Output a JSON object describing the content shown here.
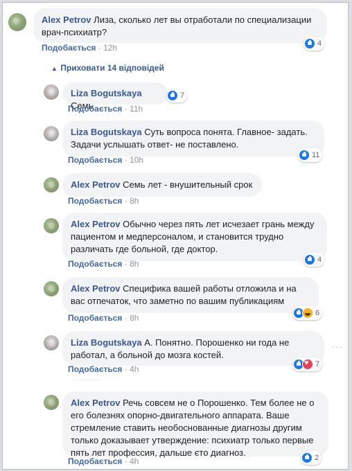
{
  "top_comment": {
    "author": "Alex Petrov",
    "text": "Лиза, сколько лет вы отработали по специализации врач-психиатр?",
    "like_label": "Подобається",
    "time": "12h",
    "reaction_count": "4"
  },
  "hide_replies_label": "Приховати 14 відповідей",
  "replies": [
    {
      "author": "Liza Bogutskaya",
      "text": "Семь",
      "like_label": "Подобається",
      "time": "11h",
      "reaction_count": "7"
    },
    {
      "author": "Liza Bogutskaya",
      "text": "Суть вопроса понята. Главное- задать. Задачи услышать ответ- не поставлено.",
      "like_label": "Подобається",
      "time": "10h",
      "reaction_count": "11"
    },
    {
      "author": "Alex Petrov",
      "text": "Семь лет - внушительный срок",
      "like_label": "Подобається",
      "time": "8h"
    },
    {
      "author": "Alex Petrov",
      "text": "Обычно через пять лет исчезает грань между пациентом и медперсоналом, и становится трудно различать где больной, где доктор.",
      "like_label": "Подобається",
      "time": "8h",
      "reaction_count": "4"
    },
    {
      "author": "Alex Petrov",
      "text": "Специфика вашей работы отложила и на вас отпечаток, что заметно по вашим публикациям",
      "like_label": "Подобається",
      "time": "8h",
      "reaction_count": "6"
    },
    {
      "author": "Liza Bogutskaya",
      "text": "А. Понятно. Порошенко ни года не работал, а больной до мозга костей.",
      "like_label": "Подобається",
      "time": "4h",
      "reaction_count": "7"
    },
    {
      "author": "Alex Petrov",
      "text": "Речь совсем не о Порошенко. Тем более не о его болезнях опорно-двигательного аппарата. Ваше стремление ставить необоснованные диагнозы другим только доказывает утверждение: психиатр только первые пять лет профессия, дальше єто диагноз.",
      "like_label": "Подобається",
      "time": "4h",
      "reaction_count": "2"
    }
  ],
  "separator": "·",
  "colors": {
    "link": "#4267b2",
    "author": "#385898",
    "bubble": "#f2f3f5",
    "meta": "#90949c"
  }
}
